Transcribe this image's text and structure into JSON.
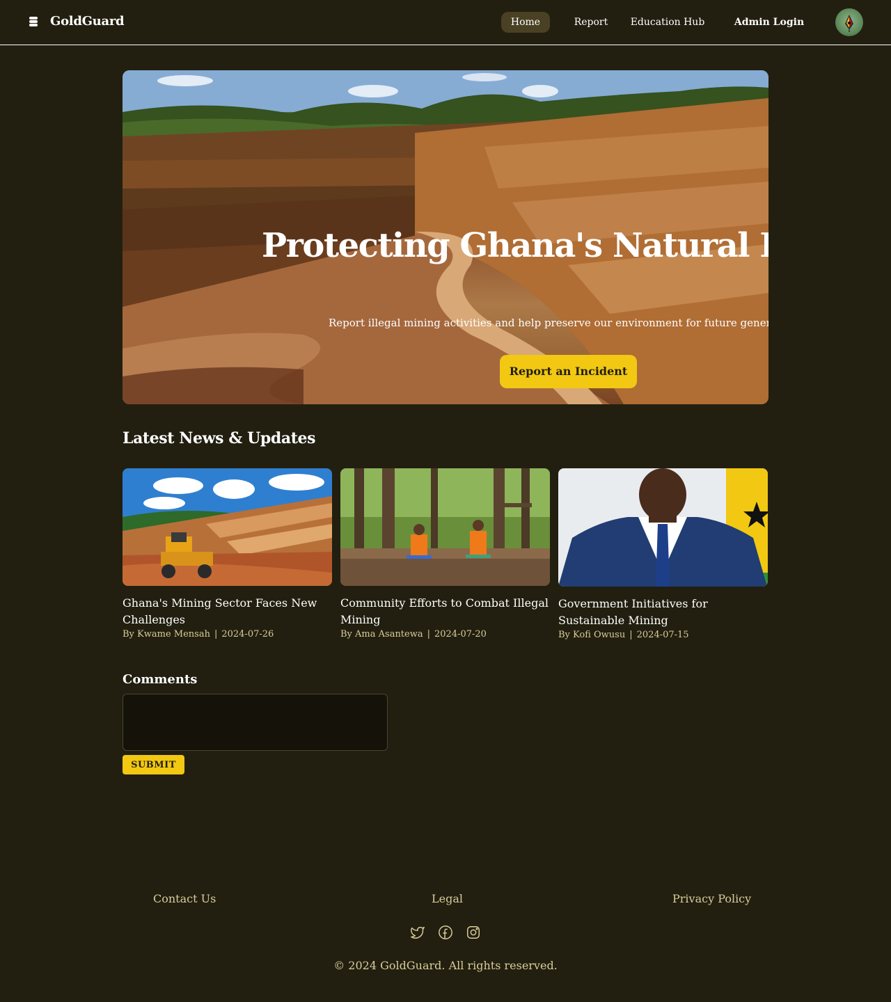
{
  "brand": {
    "name": "GoldGuard",
    "icon": "stack-icon"
  },
  "nav": {
    "home": "Home",
    "report": "Report",
    "education": "Education Hub",
    "admin": "Admin Login",
    "active": "Home"
  },
  "hero": {
    "title": "Protecting Ghana's Natural Resources",
    "subtitle": "Report illegal mining activities and help preserve our environment for future generations.",
    "cta": "Report an Incident"
  },
  "news": {
    "heading": "Latest News & Updates",
    "items": [
      {
        "title": "Ghana's Mining Sector Faces New Challenges",
        "author": "By Kwame Mensah",
        "date": "2024-07-26"
      },
      {
        "title": "Community Efforts to Combat Illegal Mining",
        "author": "By Ama Asantewa",
        "date": "2024-07-20"
      },
      {
        "title": "Government Initiatives for Sustainable Mining",
        "author": "By Kofi Owusu",
        "date": "2024-07-15"
      }
    ]
  },
  "comments": {
    "heading": "Comments",
    "value": "",
    "placeholder": "",
    "submit": "SUBMIT"
  },
  "footer": {
    "contact": "Contact Us",
    "legal": "Legal",
    "privacy": "Privacy Policy",
    "social": [
      "twitter-icon",
      "facebook-icon",
      "instagram-icon"
    ],
    "copyright": "© 2024 GoldGuard. All rights reserved."
  },
  "colors": {
    "background": "#221f10",
    "accent": "#f2c812",
    "muted_text": "#d9cd9a",
    "active_nav": "#4a4124"
  }
}
